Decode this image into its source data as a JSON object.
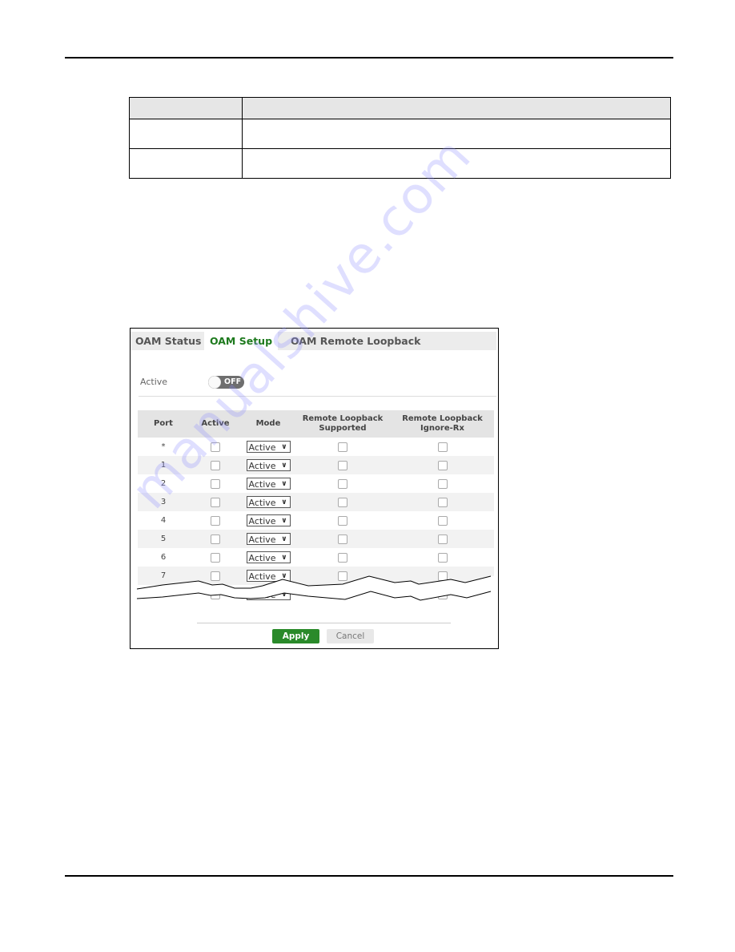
{
  "ui": {
    "tabs": [
      {
        "label": "OAM Status",
        "selected": false
      },
      {
        "label": "OAM Setup",
        "selected": true
      },
      {
        "label": "OAM Remote Loopback",
        "selected": false
      }
    ],
    "global_active": {
      "label": "Active",
      "state": "OFF"
    },
    "table": {
      "headers": {
        "port": "Port",
        "active": "Active",
        "mode": "Mode",
        "rl_supported_line1": "Remote Loopback",
        "rl_supported_line2": "Supported",
        "rl_ignore_line1": "Remote Loopback",
        "rl_ignore_line2": "Ignore-Rx"
      },
      "rows": [
        {
          "port": "*",
          "active": false,
          "mode": "Active",
          "rl_supported": false,
          "rl_ignore_rx": false
        },
        {
          "port": "1",
          "active": false,
          "mode": "Active",
          "rl_supported": false,
          "rl_ignore_rx": false
        },
        {
          "port": "2",
          "active": false,
          "mode": "Active",
          "rl_supported": false,
          "rl_ignore_rx": false
        },
        {
          "port": "3",
          "active": false,
          "mode": "Active",
          "rl_supported": false,
          "rl_ignore_rx": false
        },
        {
          "port": "4",
          "active": false,
          "mode": "Active",
          "rl_supported": false,
          "rl_ignore_rx": false
        },
        {
          "port": "5",
          "active": false,
          "mode": "Active",
          "rl_supported": false,
          "rl_ignore_rx": false
        },
        {
          "port": "6",
          "active": false,
          "mode": "Active",
          "rl_supported": false,
          "rl_ignore_rx": false
        },
        {
          "port": "7",
          "active": false,
          "mode": "Active",
          "rl_supported": false,
          "rl_ignore_rx": false
        },
        {
          "port": "",
          "active": false,
          "mode": "Active",
          "rl_supported": false,
          "rl_ignore_rx": false
        }
      ]
    },
    "buttons": {
      "apply": "Apply",
      "cancel": "Cancel"
    },
    "colors": {
      "accent_green": "#2a8a2a",
      "active_tab_text": "#1e7a1e"
    }
  },
  "watermark": "manualshive.com"
}
